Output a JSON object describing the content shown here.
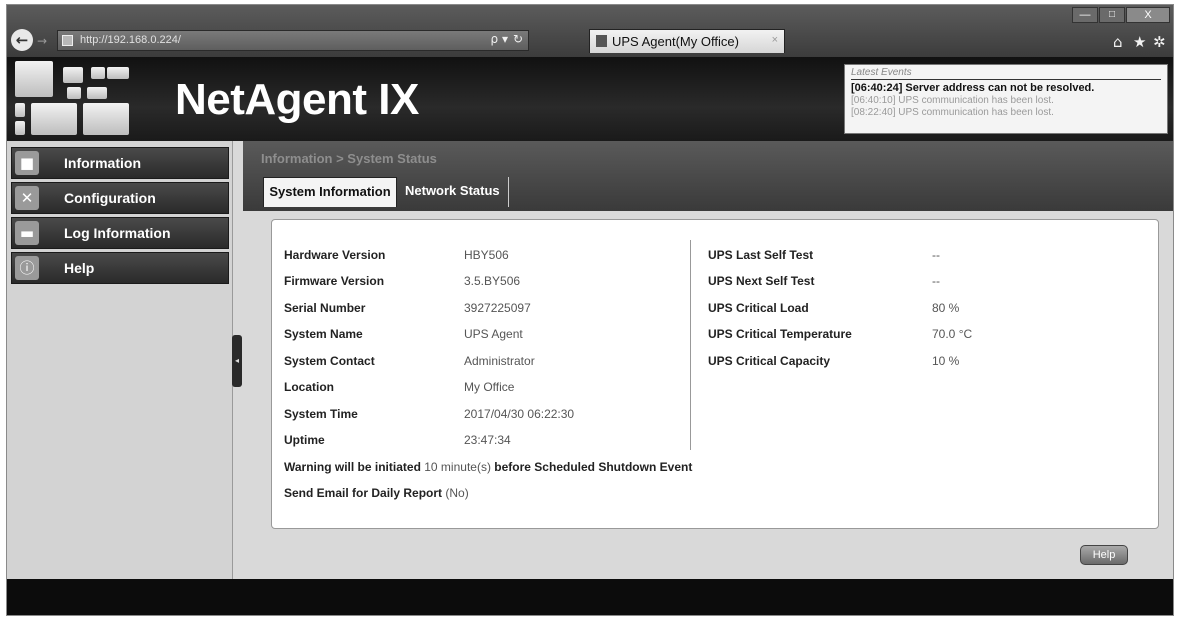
{
  "browser": {
    "url": "http://192.168.0.224/",
    "search_glyph": "ρ",
    "dropdown_glyph": "▾",
    "refresh_glyph": "↻",
    "tab_title": "UPS Agent(My Office)",
    "tab_close": "×",
    "minimize": "—",
    "maximize": "□",
    "close": "X",
    "home_glyph": "⌂",
    "favorites_glyph": "★",
    "settings_glyph": "✲"
  },
  "app": {
    "title": "NetAgent IX"
  },
  "events": {
    "title": "Latest Events",
    "items": [
      "[06:40:24] Server address can not be resolved.",
      "[06:40:10] UPS communication has been lost.",
      "[08:22:40] UPS communication has been lost."
    ]
  },
  "sidebar": {
    "items": [
      {
        "label": "Information",
        "icon": "■"
      },
      {
        "label": "Configuration",
        "icon": "✕"
      },
      {
        "label": "Log Information",
        "icon": "▬"
      },
      {
        "label": "Help",
        "icon": "ⓘ"
      }
    ],
    "toggle_glyph": "◂"
  },
  "content": {
    "breadcrumb": "Information > System Status",
    "tabs": [
      "System Information",
      "Network Status"
    ],
    "left_rows": [
      {
        "label": "Hardware Version",
        "value": "HBY506"
      },
      {
        "label": "Firmware Version",
        "value": "3.5.BY506"
      },
      {
        "label": "Serial Number",
        "value": "3927225097"
      },
      {
        "label": "System Name",
        "value": "UPS Agent"
      },
      {
        "label": "System Contact",
        "value": "Administrator"
      },
      {
        "label": "Location",
        "value": "My Office"
      },
      {
        "label": "System Time",
        "value": "2017/04/30 06:22:30"
      },
      {
        "label": "Uptime",
        "value": "23:47:34"
      }
    ],
    "right_rows": [
      {
        "label": "UPS Last Self Test",
        "value": "--"
      },
      {
        "label": "UPS Next Self Test",
        "value": "--"
      },
      {
        "label": "UPS Critical Load",
        "value": "80 %"
      },
      {
        "label": "UPS Critical Temperature",
        "value": "70.0 °C"
      },
      {
        "label": "UPS Critical Capacity",
        "value": "10 %"
      }
    ],
    "warning": {
      "prefix": "Warning will be initiated",
      "value": "10 minute(s)",
      "suffix": "before Scheduled Shutdown Event"
    },
    "email": {
      "prefix": "Send Email for Daily Report",
      "value": "(No)"
    },
    "help_button": "Help"
  }
}
